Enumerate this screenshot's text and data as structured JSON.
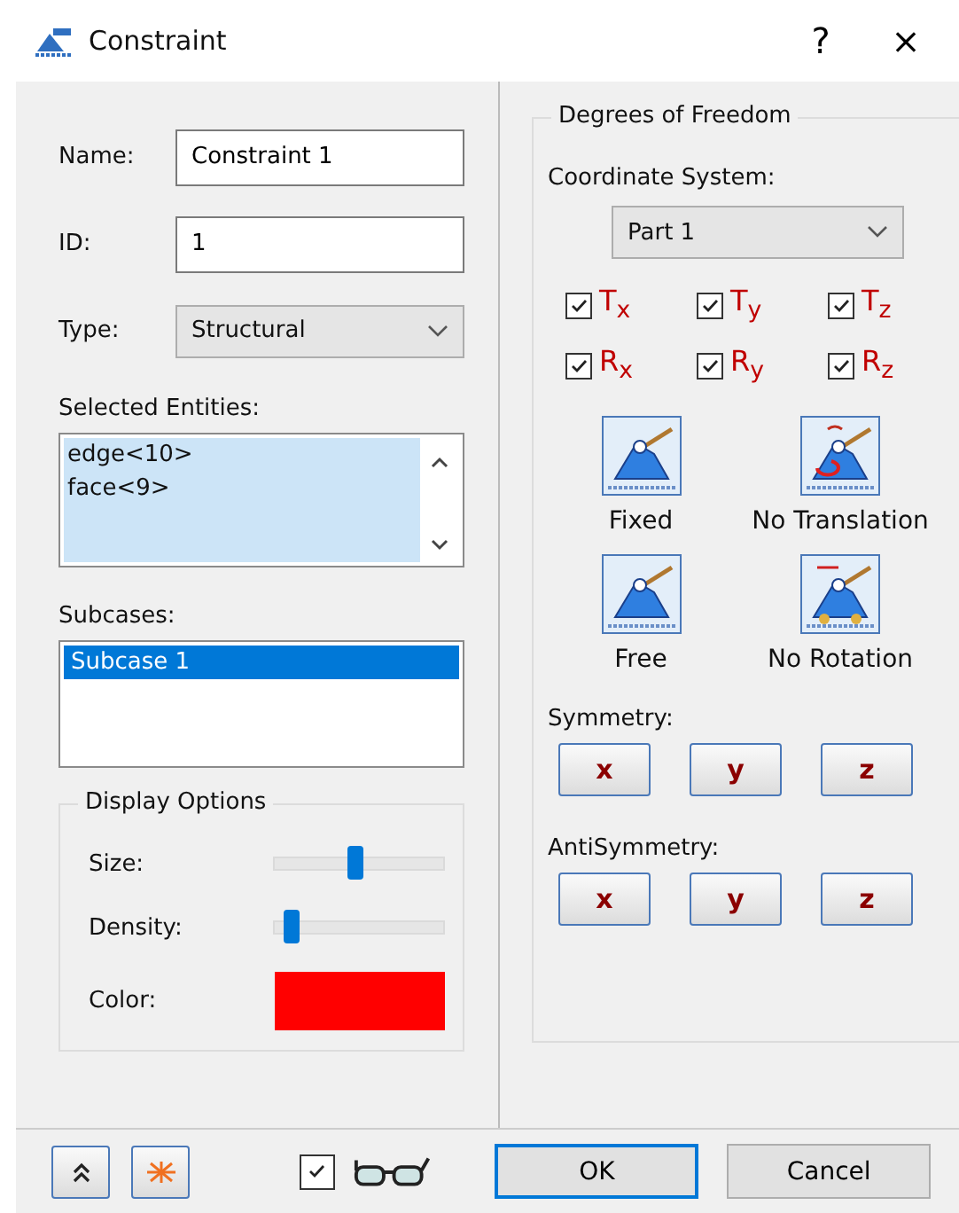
{
  "window": {
    "title": "Constraint",
    "help": "?",
    "close": "×"
  },
  "fields": [
    {
      "label": "Name:",
      "value": "Constraint 1"
    },
    {
      "label": "ID:",
      "value": "1"
    }
  ],
  "type": {
    "label": "Type:",
    "value": "Structural"
  },
  "selected_entities": {
    "label": "Selected Entities:",
    "items": [
      "edge<10>",
      "face<9>"
    ]
  },
  "subcases": {
    "label": "Subcases:",
    "items": [
      {
        "label": "Subcase 1",
        "selected": true
      }
    ]
  },
  "display_options": {
    "title": "Display Options",
    "sliders": [
      {
        "label": "Size:",
        "level": 0.47
      },
      {
        "label": "Density:",
        "level": 0.1
      }
    ],
    "color": {
      "label": "Color:",
      "color": "#ff0000"
    }
  },
  "dof": {
    "title": "Degrees of Freedom",
    "coord_label": "Coordinate System:",
    "coord_value": "Part 1",
    "checks": [
      {
        "label": "T$_{x}$",
        "checked": true
      },
      {
        "label": "T$_{y}$",
        "checked": true
      },
      {
        "label": "T$_{z}$",
        "checked": true
      },
      {
        "label": "R$_{x}$",
        "checked": true
      },
      {
        "label": "R$_{y}$",
        "checked": true
      },
      {
        "label": "R$_{z}$",
        "checked": true
      }
    ],
    "presets": [
      {
        "label": "Fixed",
        "kind": "fixed"
      },
      {
        "label": "No Translation",
        "kind": "notranslation"
      },
      {
        "label": "Free",
        "kind": "free"
      },
      {
        "label": "No Rotation",
        "kind": "norotation"
      }
    ],
    "symmetry": {
      "label": "Symmetry:",
      "buttons": [
        "x",
        "y",
        "z"
      ]
    },
    "antisymmetry": {
      "label": "AntiSymmetry:",
      "buttons": [
        "x",
        "y",
        "z"
      ]
    }
  },
  "footer": {
    "show_checked": true,
    "ok": "OK",
    "cancel": "Cancel"
  }
}
